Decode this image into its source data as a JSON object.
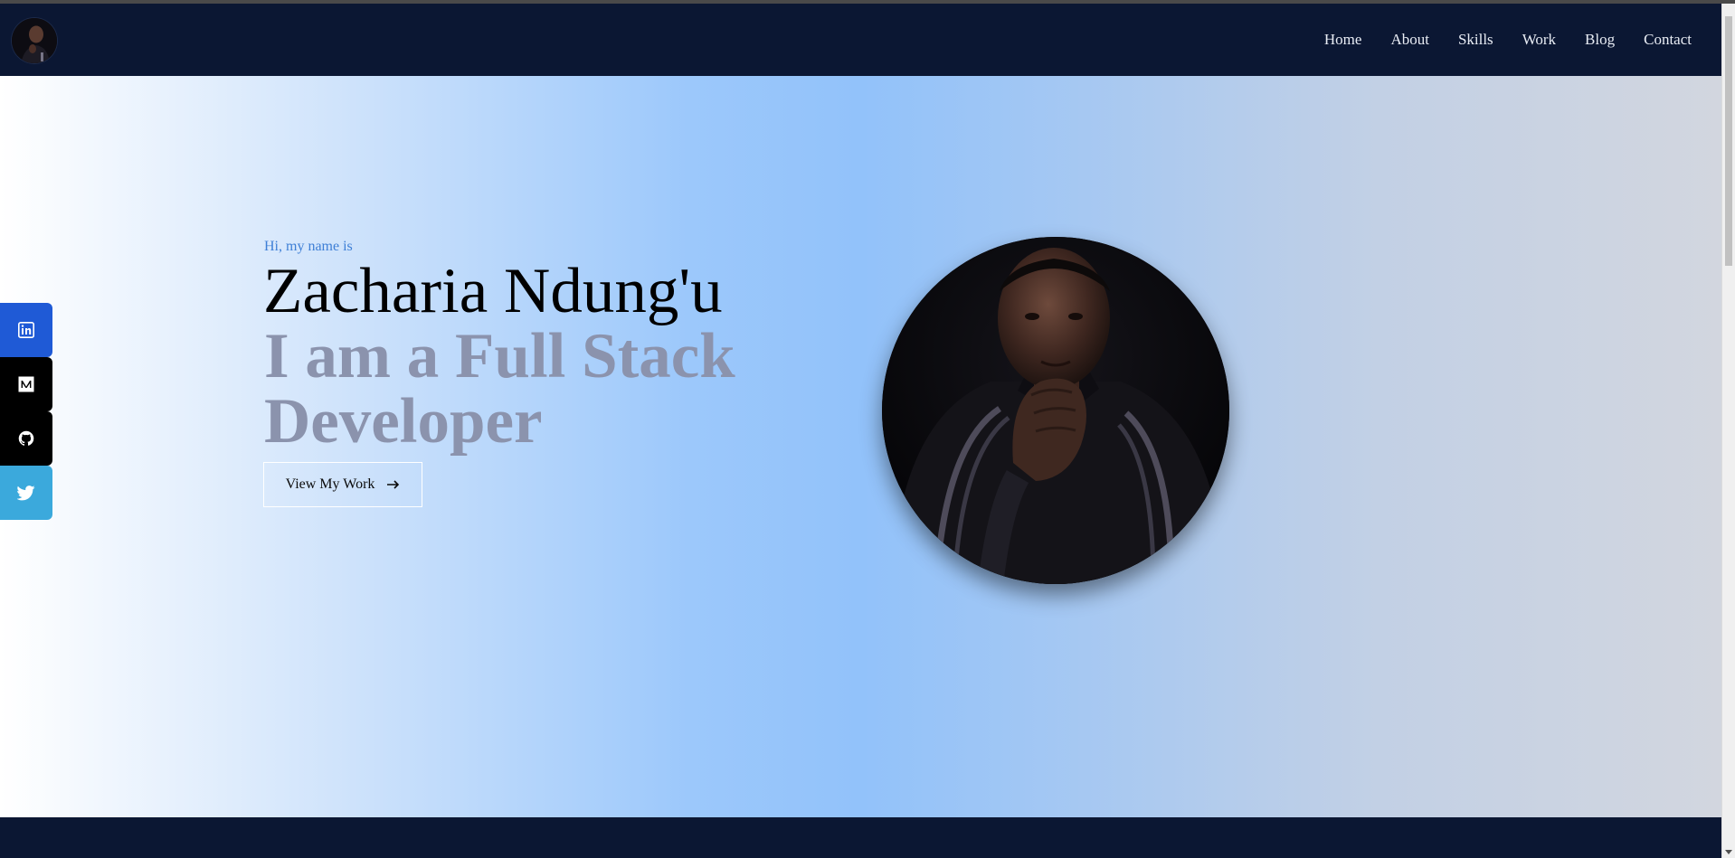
{
  "nav": {
    "logo_icon": "avatar-photo",
    "links": [
      {
        "label": "Home"
      },
      {
        "label": "About"
      },
      {
        "label": "Skills"
      },
      {
        "label": "Work"
      },
      {
        "label": "Blog"
      },
      {
        "label": "Contact"
      }
    ]
  },
  "hero": {
    "intro": "Hi, my name is",
    "name": "Zacharia Ndung'u",
    "role": "I am a Full Stack Developer",
    "cta_label": "View My Work",
    "cta_icon": "arrow-right-icon"
  },
  "social": [
    {
      "network": "LinkedIn",
      "icon": "linkedin-icon",
      "color": "#1f5ad6"
    },
    {
      "network": "Medium",
      "icon": "medium-icon",
      "color": "#000000"
    },
    {
      "network": "GitHub",
      "icon": "github-icon",
      "color": "#000000"
    },
    {
      "network": "Twitter",
      "icon": "twitter-icon",
      "color": "#3ba9dc"
    }
  ],
  "colors": {
    "navy": "#0b1733",
    "accent_blue": "#3e7fd6",
    "role_gray": "#8b93ad"
  }
}
